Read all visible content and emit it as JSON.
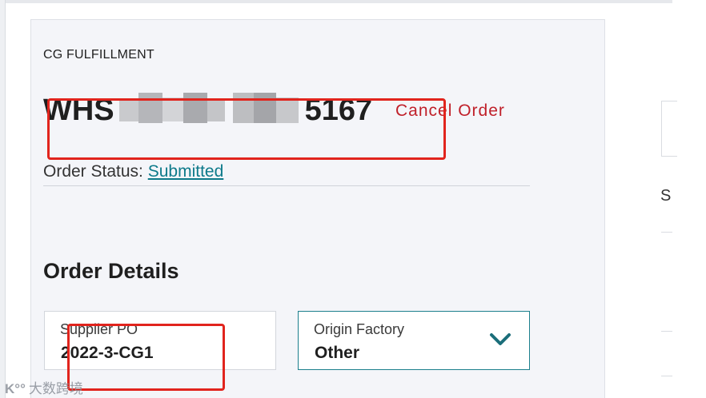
{
  "header": {
    "eyebrow": "CG FULFILLMENT"
  },
  "order": {
    "id_prefix": "WHS",
    "id_suffix": "5167",
    "cancel_label": "Cancel Order",
    "status_label": "Order Status:",
    "status_value": "Submitted"
  },
  "details": {
    "title": "Order Details",
    "supplier_po": {
      "label": "Supplier PO",
      "value": "2022-3-CG1"
    },
    "origin_factory": {
      "label": "Origin Factory",
      "value": "Other"
    }
  },
  "side": {
    "partial_text": "S"
  },
  "watermark": {
    "logo": "K°°",
    "text": "大数跨境"
  },
  "colors": {
    "accent": "#0d7a8a",
    "danger": "#c0202a",
    "highlight": "#e1241d",
    "panel": "#f4f5f9"
  },
  "icons": {
    "origin_dropdown": "chevron-down-icon"
  }
}
